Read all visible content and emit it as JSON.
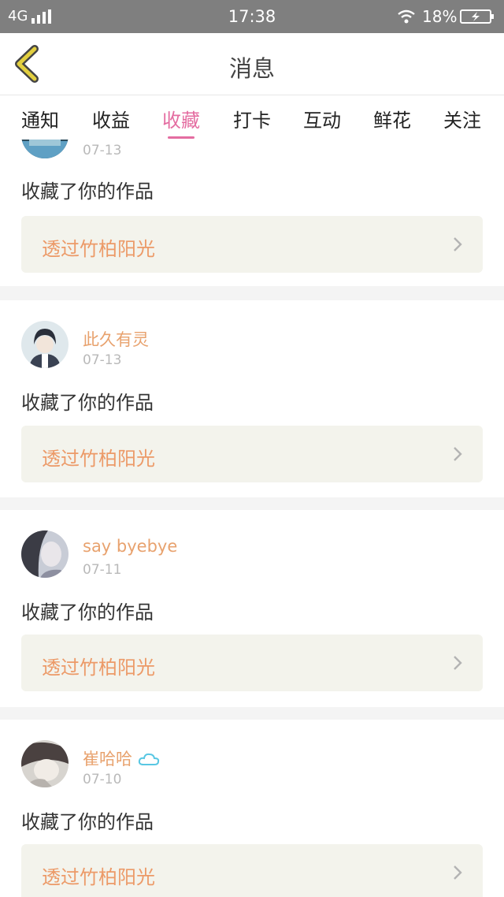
{
  "status_bar": {
    "network": "4G",
    "time": "17:38",
    "battery": "18%"
  },
  "header": {
    "title": "消息"
  },
  "tabs": [
    {
      "label": "通知"
    },
    {
      "label": "收益"
    },
    {
      "label": "收藏",
      "active": true
    },
    {
      "label": "打卡"
    },
    {
      "label": "互动"
    },
    {
      "label": "鲜花"
    },
    {
      "label": "关注"
    }
  ],
  "notifications": [
    {
      "user": "",
      "date": "07-13",
      "action": "收藏了你的作品",
      "work_title": "透过竹柏阳光"
    },
    {
      "user": "此久有灵",
      "date": "07-13",
      "action": "收藏了你的作品",
      "work_title": "透过竹柏阳光"
    },
    {
      "user": "say byebye",
      "date": "07-11",
      "action": "收藏了你的作品",
      "work_title": "透过竹柏阳光"
    },
    {
      "user": "崔哈哈",
      "date": "07-10",
      "action": "收藏了你的作品",
      "work_title": "透过竹柏阳光",
      "badge_icon": "cloud-icon"
    }
  ],
  "colors": {
    "accent": "#e46da1",
    "username": "#e8a26e",
    "work_title": "#ec9a68",
    "back_icon": "#e2cf3f"
  }
}
